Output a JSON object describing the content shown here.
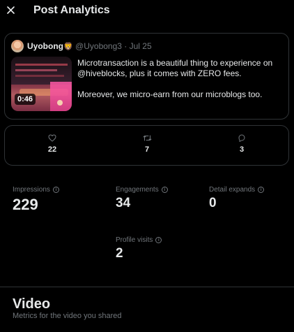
{
  "header": {
    "close_icon": "close-icon",
    "title": "Post Analytics"
  },
  "post": {
    "author_name": "Uyobong",
    "author_emoji": "🦁",
    "author_handle": "@Uyobong3",
    "separator": "·",
    "date": "Jul 25",
    "video_duration": "0:46",
    "text_lines": [
      "Microtransaction is a beautiful thing to experience on @hiveblocks, plus it comes with ZERO fees.",
      "Moreover, we micro-earn from our microblogs too."
    ]
  },
  "engagement_bar": {
    "likes": {
      "icon": "heart-icon",
      "count": "22"
    },
    "reposts": {
      "icon": "repost-icon",
      "count": "7"
    },
    "replies": {
      "icon": "reply-icon",
      "count": "3"
    }
  },
  "metrics": {
    "impressions": {
      "label": "Impressions",
      "value": "229"
    },
    "engagements": {
      "label": "Engagements",
      "value": "34"
    },
    "detail_expands": {
      "label": "Detail expands",
      "value": "0"
    },
    "profile_visits": {
      "label": "Profile visits",
      "value": "2"
    }
  },
  "video_section": {
    "title": "Video",
    "subtitle": "Metrics for the video you shared"
  },
  "colors": {
    "background": "#000000",
    "text_primary": "#e7e9ea",
    "text_secondary": "#71767b",
    "border": "#2f3336"
  }
}
